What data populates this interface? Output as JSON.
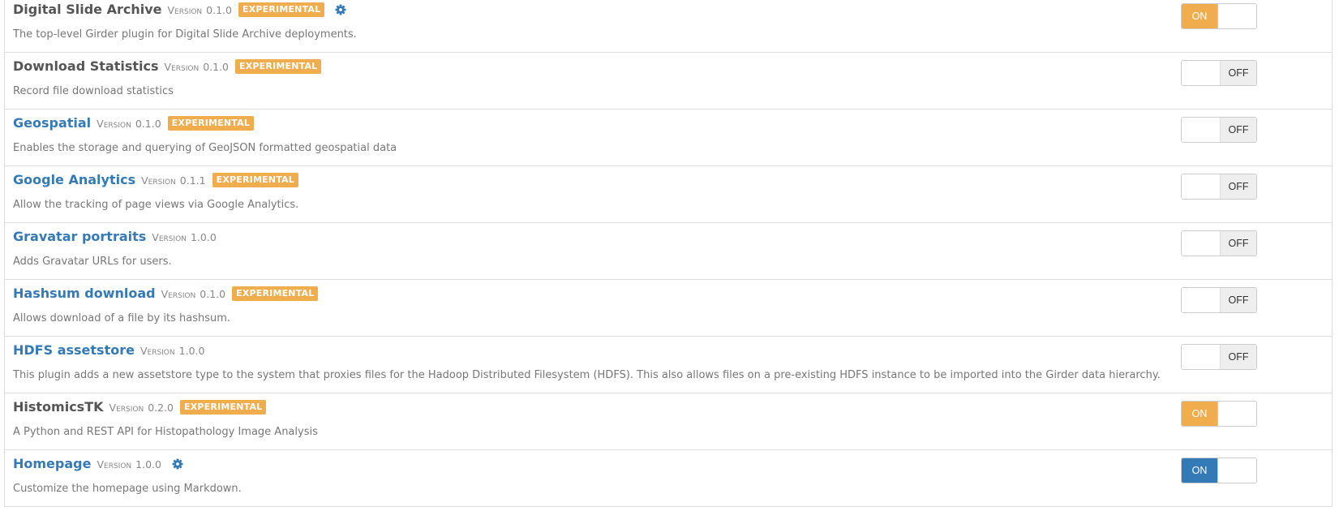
{
  "version_word": "Version",
  "experimental_label": "EXPERIMENTAL",
  "colors": {
    "link": "#337ab7",
    "experimental": "#f0ad4e",
    "toggle_on_warning": "#f0ad4e",
    "toggle_on_primary": "#337ab7"
  },
  "plugins": [
    {
      "name": "Digital Slide Archive",
      "version": "0.1.0",
      "experimental": true,
      "configurable": true,
      "enabled": true,
      "toggle_label": "ON",
      "description": "The top-level Girder plugin for Digital Slide Archive deployments."
    },
    {
      "name": "Download Statistics",
      "version": "0.1.0",
      "experimental": true,
      "configurable": false,
      "enabled": false,
      "toggle_label": "OFF",
      "description": "Record file download statistics"
    },
    {
      "name": "Geospatial",
      "version": "0.1.0",
      "experimental": true,
      "configurable": false,
      "enabled": false,
      "toggle_label": "OFF",
      "description": "Enables the storage and querying of GeoJSON formatted geospatial data"
    },
    {
      "name": "Google Analytics",
      "version": "0.1.1",
      "experimental": true,
      "configurable": false,
      "enabled": false,
      "toggle_label": "OFF",
      "description": "Allow the tracking of page views via Google Analytics."
    },
    {
      "name": "Gravatar portraits",
      "version": "1.0.0",
      "experimental": false,
      "configurable": false,
      "enabled": false,
      "toggle_label": "OFF",
      "description": "Adds Gravatar URLs for users."
    },
    {
      "name": "Hashsum download",
      "version": "0.1.0",
      "experimental": true,
      "configurable": false,
      "enabled": false,
      "toggle_label": "OFF",
      "description": "Allows download of a file by its hashsum."
    },
    {
      "name": "HDFS assetstore",
      "version": "1.0.0",
      "experimental": false,
      "configurable": false,
      "enabled": false,
      "toggle_label": "OFF",
      "description": "This plugin adds a new assetstore type to the system that proxies files for the Hadoop Distributed Filesystem (HDFS). This also allows files on a pre-existing HDFS instance to be imported into the Girder data hierarchy."
    },
    {
      "name": "HistomicsTK",
      "version": "0.2.0",
      "experimental": true,
      "configurable": false,
      "enabled": true,
      "toggle_label": "ON",
      "description": "A Python and REST API for Histopathology Image Analysis"
    },
    {
      "name": "Homepage",
      "version": "1.0.0",
      "experimental": false,
      "configurable": true,
      "enabled": true,
      "toggle_label": "ON",
      "description": "Customize the homepage using Markdown."
    }
  ]
}
